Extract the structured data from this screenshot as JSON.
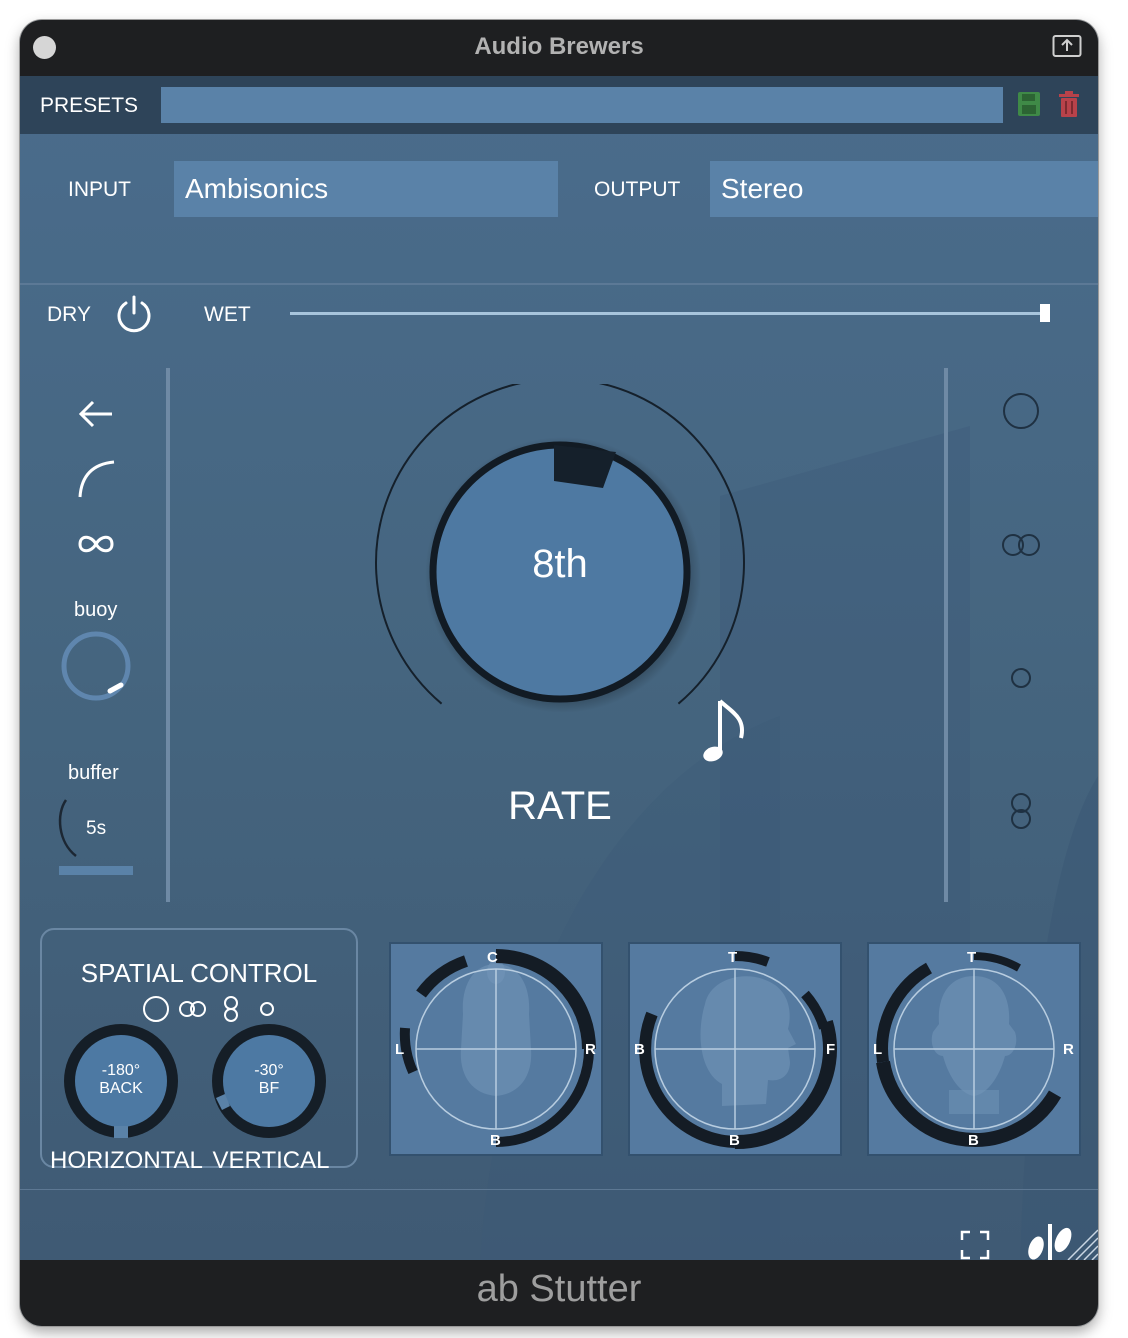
{
  "window": {
    "title": "Audio Brewers"
  },
  "presets": {
    "label": "PRESETS",
    "value": ""
  },
  "io": {
    "input_label": "INPUT",
    "input_value": "Ambisonics",
    "output_label": "OUTPUT",
    "output_value": "Stereo"
  },
  "mix": {
    "dry_label": "DRY",
    "wet_label": "WET",
    "wet_level": 1.0
  },
  "left_panel": {
    "buoy_label": "buoy",
    "buffer_label": "buffer",
    "buffer_value": "5s"
  },
  "rate": {
    "value": "8th",
    "label": "RATE"
  },
  "spatial": {
    "title": "SPATIAL CONTROL",
    "horizontal_value": "-180°",
    "horizontal_sub": "BACK",
    "horizontal_label": "HORIZONTAL",
    "vertical_value": "-30°",
    "vertical_sub": "BF",
    "vertical_label": "VERTICAL"
  },
  "views": [
    {
      "top": "C",
      "left": "L",
      "right": "R",
      "bottom": "B"
    },
    {
      "top": "T",
      "left": "B",
      "right": "F",
      "bottom": "B"
    },
    {
      "top": "T",
      "left": "L",
      "right": "R",
      "bottom": "B"
    }
  ],
  "plugin": {
    "name": "ab Stutter"
  },
  "colors": {
    "panel_bg": "#45657f",
    "field_bg": "#5a82a8",
    "save_green": "#3f8a47",
    "delete_red": "#b8424a",
    "bar_dark": "#1e1f21"
  }
}
